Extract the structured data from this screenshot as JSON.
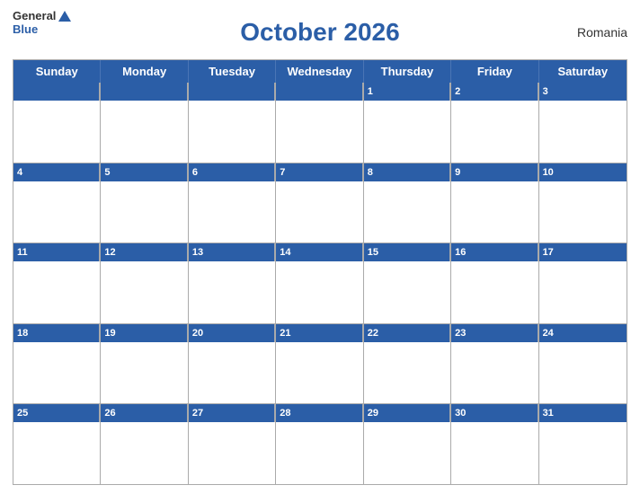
{
  "header": {
    "logo_general": "General",
    "logo_blue": "Blue",
    "title": "October 2026",
    "country": "Romania"
  },
  "days_of_week": [
    "Sunday",
    "Monday",
    "Tuesday",
    "Wednesday",
    "Thursday",
    "Friday",
    "Saturday"
  ],
  "weeks": [
    [
      null,
      null,
      null,
      null,
      1,
      2,
      3
    ],
    [
      4,
      5,
      6,
      7,
      8,
      9,
      10
    ],
    [
      11,
      12,
      13,
      14,
      15,
      16,
      17
    ],
    [
      18,
      19,
      20,
      21,
      22,
      23,
      24
    ],
    [
      25,
      26,
      27,
      28,
      29,
      30,
      31
    ]
  ]
}
